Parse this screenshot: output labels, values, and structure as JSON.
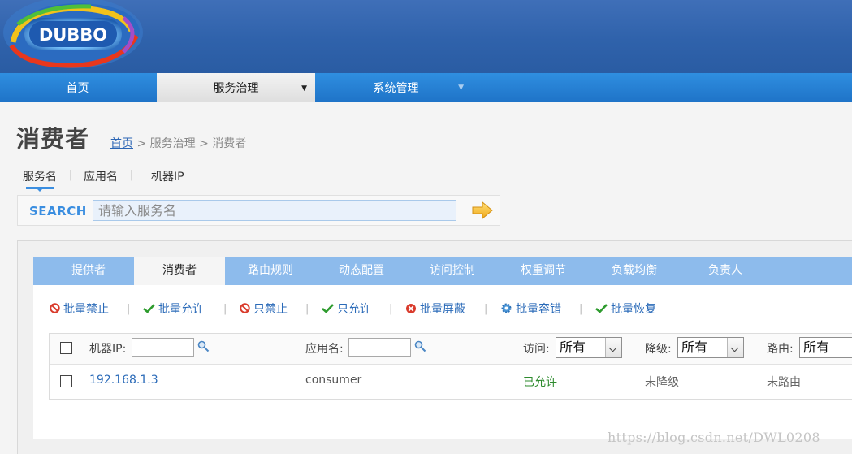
{
  "app": {
    "logo_text": "DUBBO"
  },
  "nav": {
    "items": [
      {
        "label": "首页"
      },
      {
        "label": "服务治理"
      },
      {
        "label": "系统管理"
      }
    ]
  },
  "page": {
    "title": "消费者",
    "breadcrumb": {
      "home": "首页",
      "sep": ">",
      "section": "服务治理",
      "current": "消费者"
    }
  },
  "search": {
    "tabs": [
      "服务名",
      "应用名",
      "机器IP"
    ],
    "tab_sep": "|",
    "label": "SEARCH",
    "placeholder": "请输入服务名",
    "value": ""
  },
  "subnav": {
    "tabs": [
      "提供者",
      "消费者",
      "路由规则",
      "动态配置",
      "访问控制",
      "权重调节",
      "负载均衡",
      "负责人"
    ]
  },
  "actions": [
    {
      "label": "批量禁止",
      "icon": "forbid-icon"
    },
    {
      "label": "批量允许",
      "icon": "check-icon"
    },
    {
      "label": "只禁止",
      "icon": "forbid-icon"
    },
    {
      "label": "只允许",
      "icon": "check-icon"
    },
    {
      "label": "批量屏蔽",
      "icon": "block-icon"
    },
    {
      "label": "批量容错",
      "icon": "gear-icon"
    },
    {
      "label": "批量恢复",
      "icon": "check-icon"
    }
  ],
  "table": {
    "filters": {
      "machine_ip_label": "机器IP:",
      "app_name_label": "应用名:",
      "access_label": "访问:",
      "access_value": "所有",
      "degrade_label": "降级:",
      "degrade_value": "所有",
      "route_label": "路由:",
      "route_value": "所有"
    },
    "rows": [
      {
        "ip": "192.168.1.3",
        "app": "consumer",
        "access": "已允许",
        "degrade": "未降级",
        "route": "未路由"
      }
    ]
  },
  "watermark": "https://blog.csdn.net/DWL0208",
  "colors": {
    "header_blue": "#2f62ab",
    "nav_blue": "#1f74c8",
    "subnav_blue": "#8dbbec",
    "link_blue": "#2a6ab8",
    "allowed_green": "#2e8b2e",
    "forbid_red": "#d93a2b"
  }
}
